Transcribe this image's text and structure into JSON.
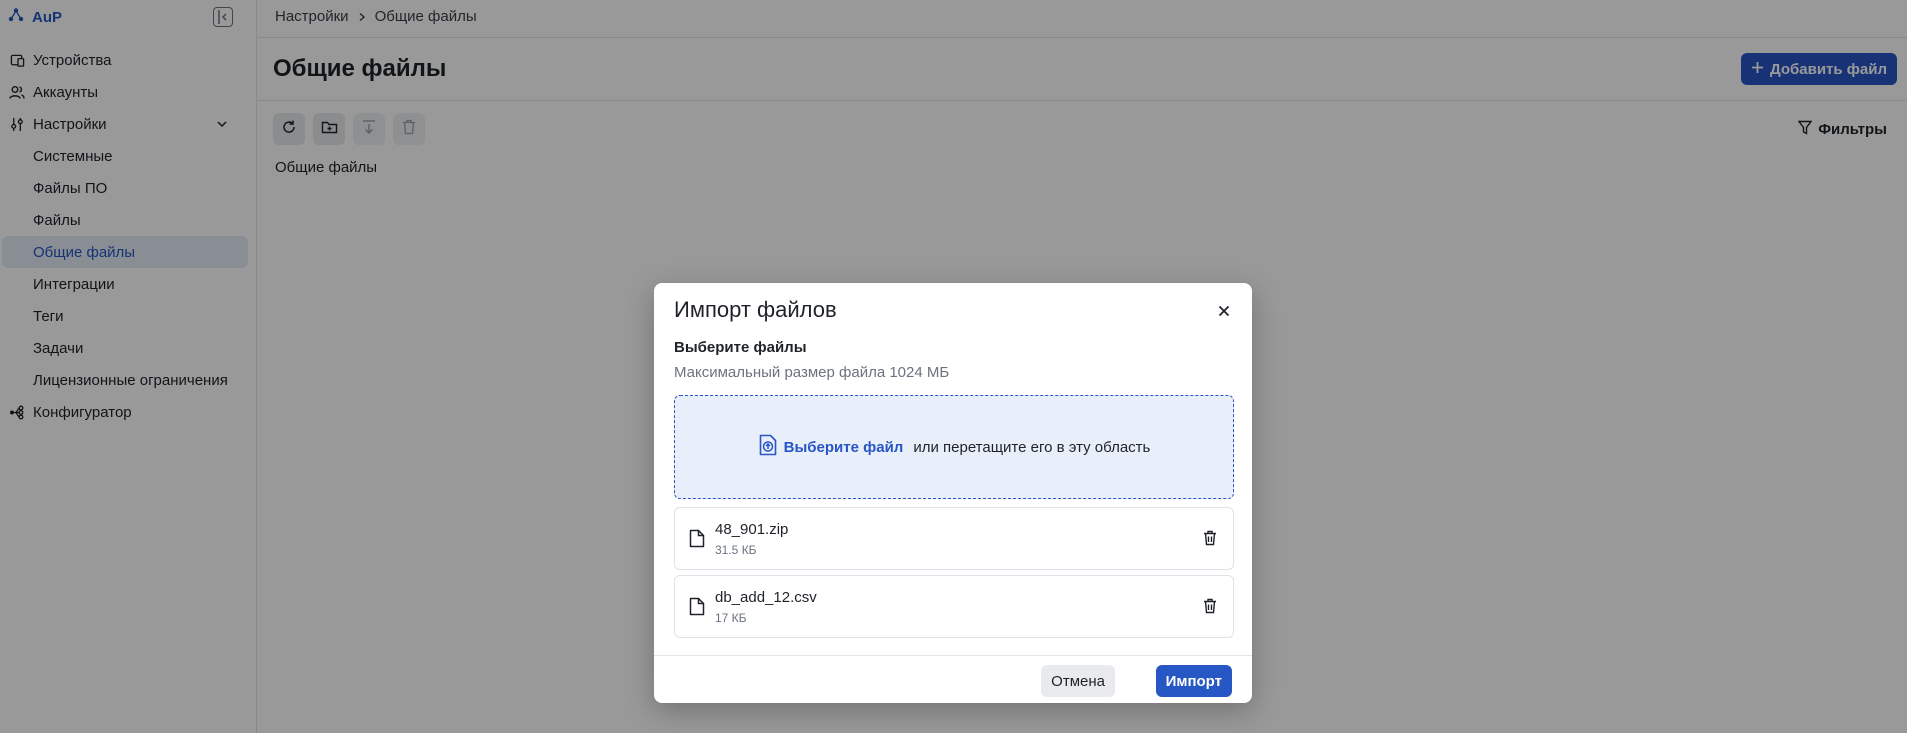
{
  "app": {
    "name": "AuP"
  },
  "sidebar": {
    "items": [
      {
        "label": "Устройства",
        "icon": "devices-icon"
      },
      {
        "label": "Аккаунты",
        "icon": "users-icon"
      },
      {
        "label": "Настройки",
        "icon": "settings-sliders-icon",
        "expanded": true
      },
      {
        "label": "Конфигуратор",
        "icon": "configurator-icon"
      }
    ],
    "settings_sub": [
      {
        "label": "Системные"
      },
      {
        "label": "Файлы ПО"
      },
      {
        "label": "Файлы"
      },
      {
        "label": "Общие файлы",
        "active": true
      },
      {
        "label": "Интеграции"
      },
      {
        "label": "Теги"
      },
      {
        "label": "Задачи"
      },
      {
        "label": "Лицензионные ограничения"
      }
    ]
  },
  "breadcrumb": {
    "parent": "Настройки",
    "current": "Общие файлы"
  },
  "page": {
    "title": "Общие файлы",
    "add_button": "Добавить файл",
    "filters_label": "Фильтры",
    "folder_label": "Общие файлы"
  },
  "modal": {
    "title": "Импорт файлов",
    "select_label": "Выберите файлы",
    "max_size": "Максимальный размер файла 1024 МБ",
    "dropzone_link": "Выберите файл",
    "dropzone_text": "или перетащите его в эту область",
    "files": [
      {
        "name": "48_901.zip",
        "size": "31.5 КБ"
      },
      {
        "name": "db_add_12.csv",
        "size": "17 КБ"
      }
    ],
    "cancel": "Отмена",
    "import": "Импорт"
  },
  "colors": {
    "accent": "#2756c5",
    "overlay": "rgba(0,0,0,0.4)"
  }
}
